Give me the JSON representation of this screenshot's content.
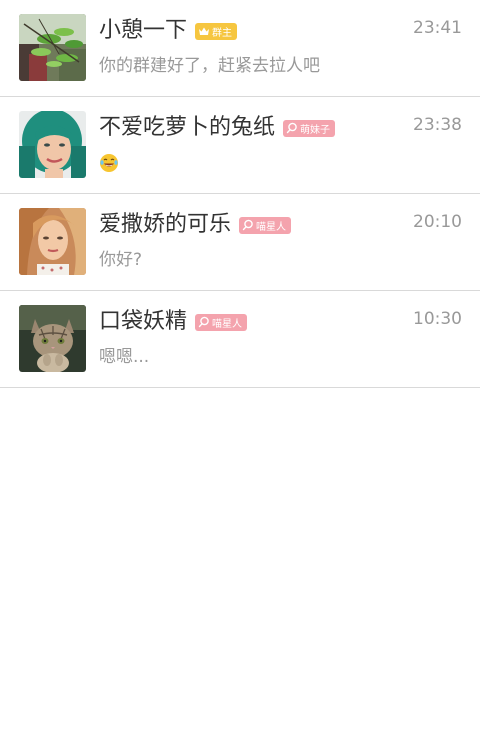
{
  "chats": [
    {
      "name": "小憩一下",
      "badge": "群主",
      "badge_type": "crown",
      "badge_color": "#f6c640",
      "time": "23:41",
      "message": "你的群建好了，赶紧去拉人吧",
      "avatar_icon": "green-leaves-photo"
    },
    {
      "name": "不爱吃萝卜的兔纸",
      "badge": "萌妹子",
      "badge_type": "search",
      "badge_color": "#f4a3ad",
      "time": "23:38",
      "message": "",
      "message_icon": "laughing-tears-emoji",
      "avatar_icon": "green-haired-girl-photo"
    },
    {
      "name": "爱撒娇的可乐",
      "badge": "喵星人",
      "badge_type": "search",
      "badge_color": "#f4a3ad",
      "time": "20:10",
      "message": "你好?",
      "avatar_icon": "blonde-woman-photo"
    },
    {
      "name": "口袋妖精",
      "badge": "喵星人",
      "badge_type": "search",
      "badge_color": "#f4a3ad",
      "time": "10:30",
      "message": "嗯嗯...",
      "avatar_icon": "kitten-photo"
    }
  ]
}
